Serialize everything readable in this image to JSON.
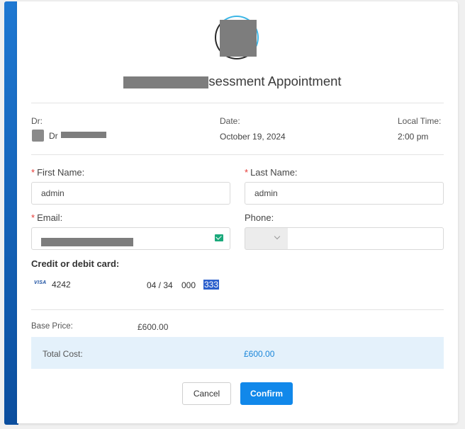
{
  "appointment": {
    "title_suffix": "sessment Appointment"
  },
  "details": {
    "dr_label": "Dr:",
    "dr_name_prefix": "Dr",
    "date_label": "Date:",
    "date_value": "October 19, 2024",
    "time_label": "Local Time:",
    "time_value": "2:00 pm"
  },
  "form": {
    "first_name_label": "First Name:",
    "first_name_value": "admin",
    "last_name_label": "Last Name:",
    "last_name_value": "admin",
    "email_label": "Email:",
    "phone_label": "Phone:",
    "required_mark": "*"
  },
  "payment": {
    "heading": "Credit or debit card:",
    "card_brand": "VISA",
    "card_last4": "4242",
    "expiry": "04 / 34",
    "cvc_unselected": "000",
    "cvc_selected": "333"
  },
  "pricing": {
    "base_label": "Base Price:",
    "base_value": "£600.00",
    "total_label": "Total Cost:",
    "total_value": "£600.00"
  },
  "buttons": {
    "cancel_label": "Cancel",
    "confirm_label": "Confirm"
  },
  "colors": {
    "accent": "#1188ea",
    "total_highlight": "#e4f1fb",
    "required": "#e53935"
  }
}
